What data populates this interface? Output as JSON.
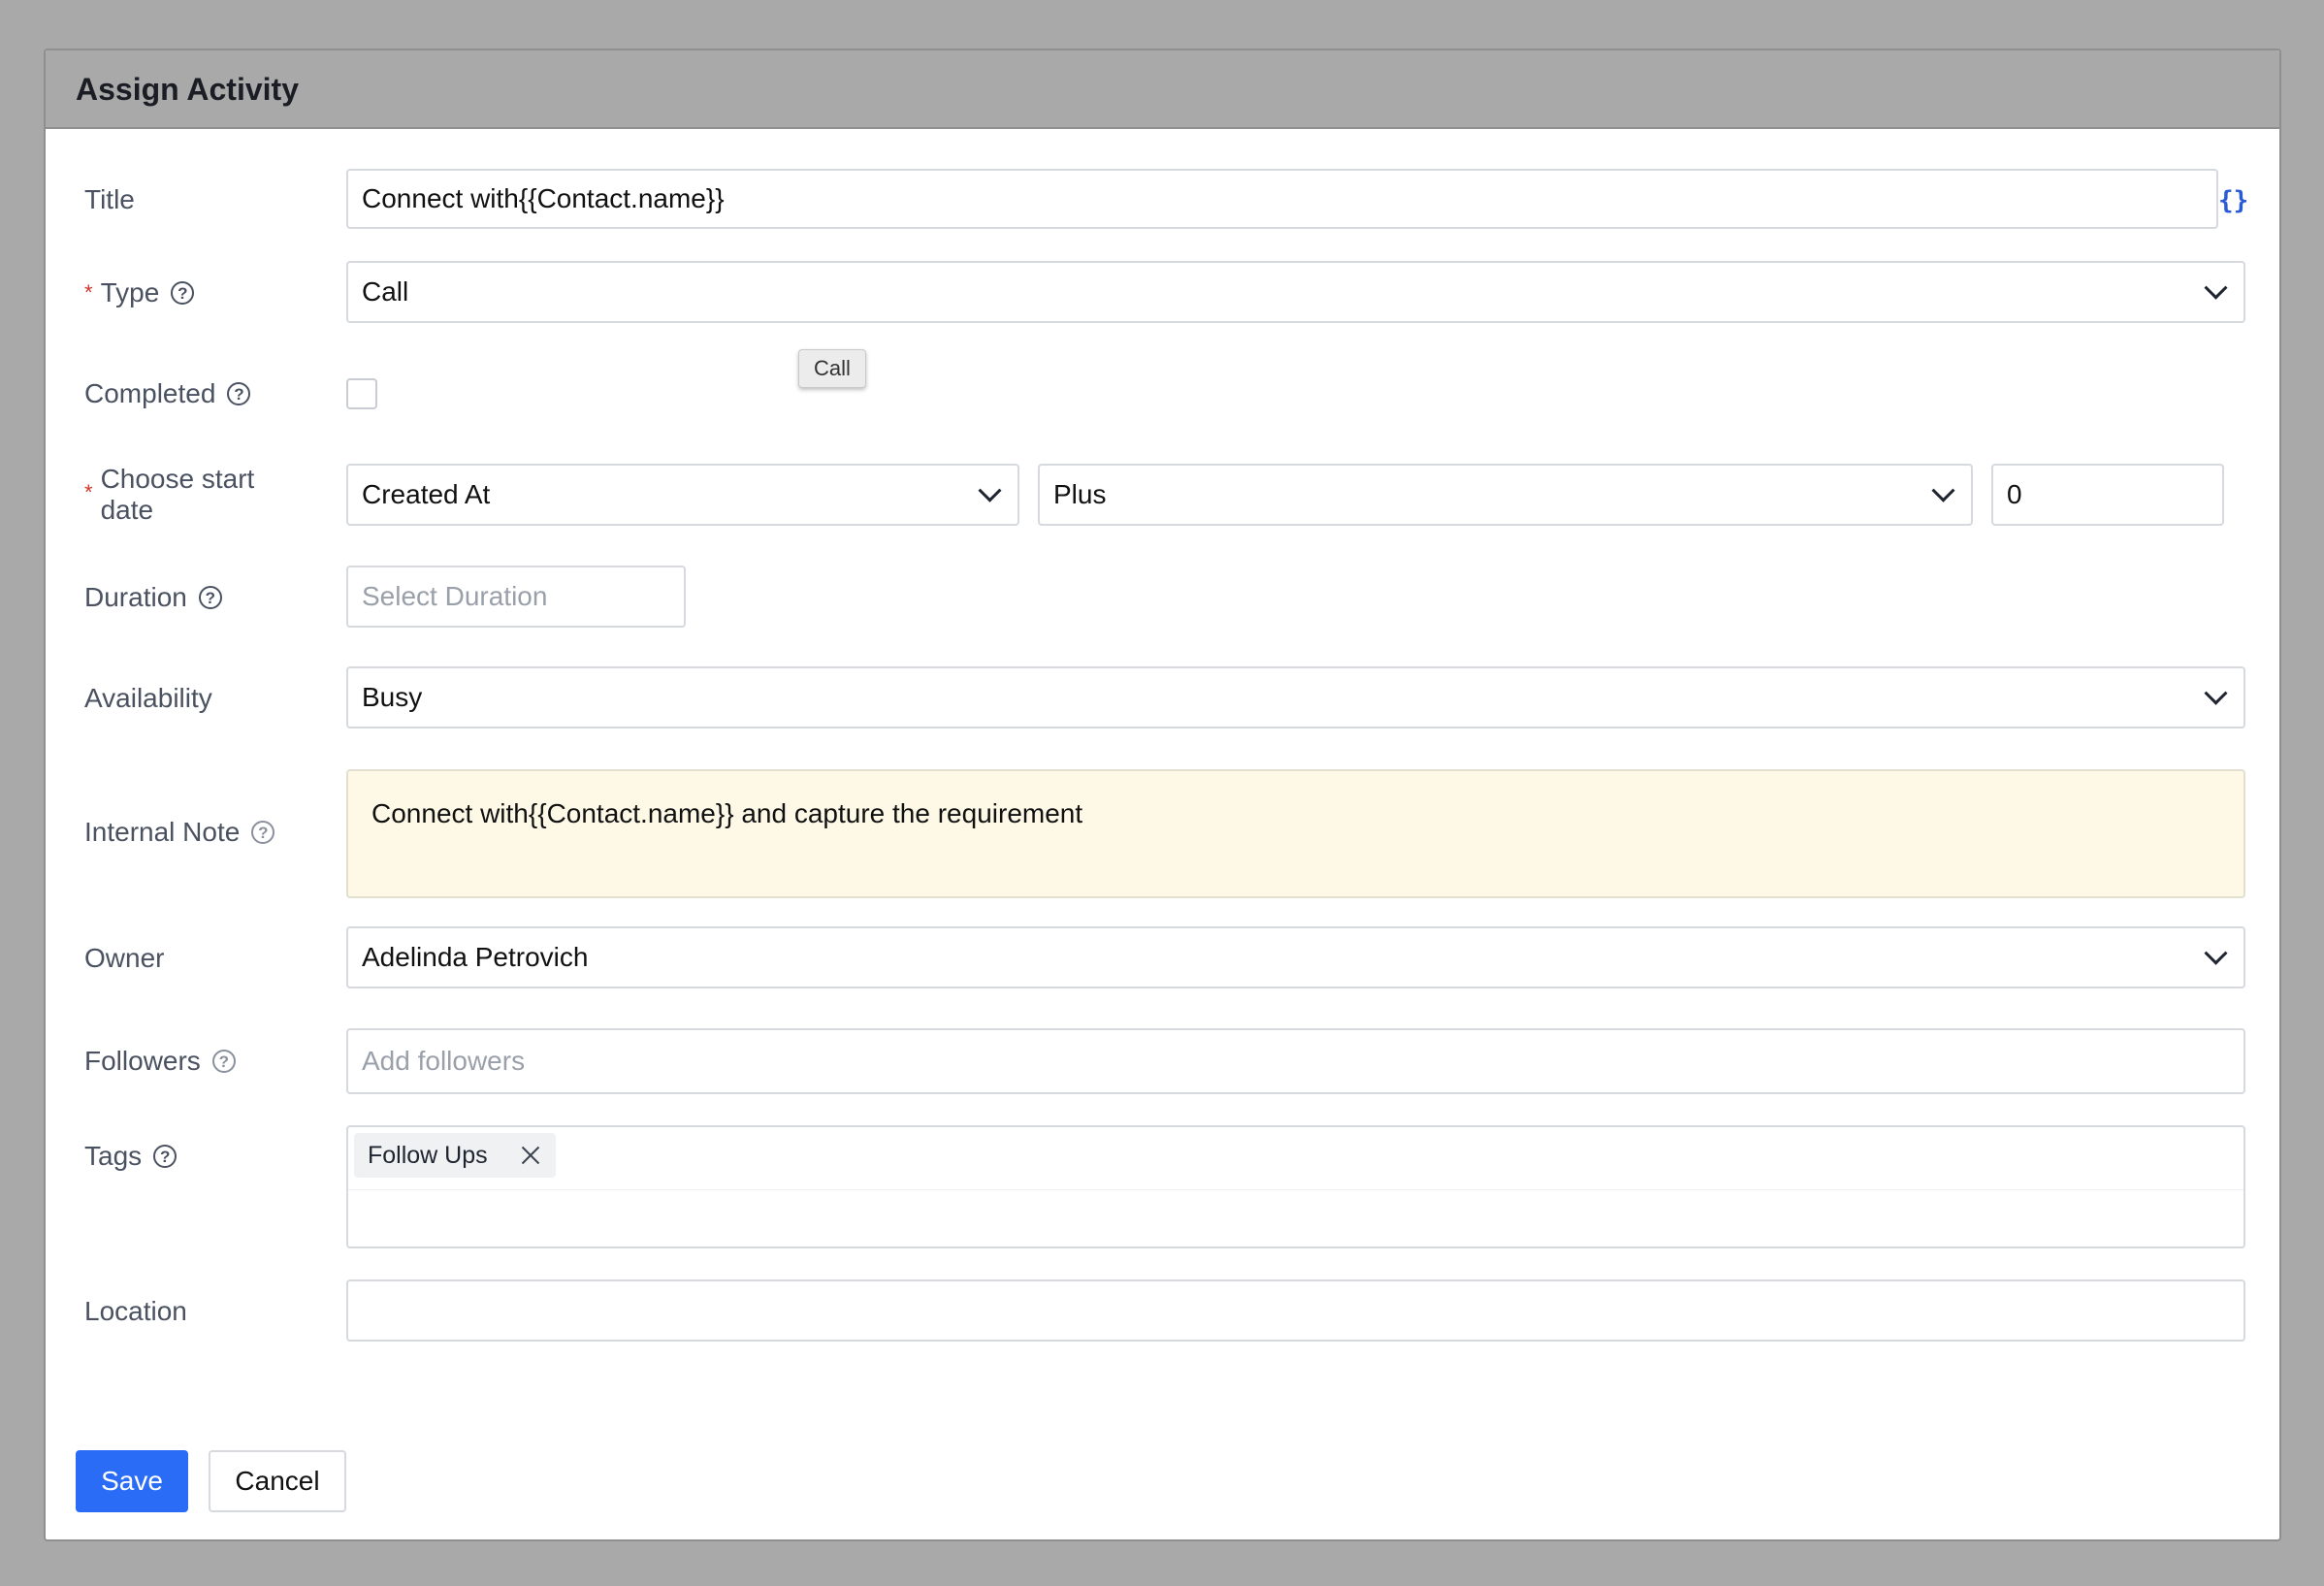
{
  "dialog": {
    "title": "Assign Activity"
  },
  "form": {
    "title": {
      "label": "Title",
      "value": "Connect with{{Contact.name}}",
      "braces": "{}"
    },
    "type": {
      "required_mark": "*",
      "label": "Type",
      "value": "Call",
      "tooltip": "Call"
    },
    "completed": {
      "label": "Completed",
      "checked": false
    },
    "start_date": {
      "required_mark": "*",
      "label_line1": "Choose start",
      "label_line2": "date",
      "basis": "Created At",
      "operator": "Plus",
      "offset": "0"
    },
    "duration": {
      "label": "Duration",
      "placeholder": "Select Duration"
    },
    "availability": {
      "label": "Availability",
      "value": "Busy"
    },
    "internal_note": {
      "label": "Internal Note",
      "value": "Connect with{{Contact.name}} and capture the requirement"
    },
    "owner": {
      "label": "Owner",
      "value": "Adelinda Petrovich"
    },
    "followers": {
      "label": "Followers",
      "placeholder": "Add followers"
    },
    "tags": {
      "label": "Tags",
      "items": [
        "Follow Ups"
      ]
    },
    "location": {
      "label": "Location",
      "value": ""
    }
  },
  "icons": {
    "help": "?"
  },
  "actions": {
    "save_label": "Save",
    "cancel_label": "Cancel"
  },
  "colors": {
    "primary": "#2b6cf6",
    "required": "#d0342c",
    "note_bg": "#fef9e7"
  }
}
